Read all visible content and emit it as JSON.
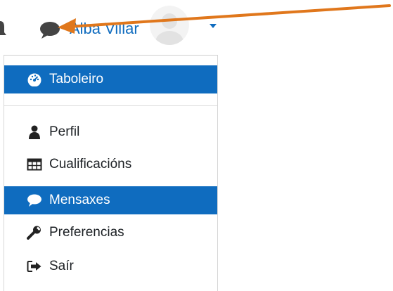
{
  "navbar": {
    "user_name": "Alba Villar",
    "icons": {
      "notifications": "bell-icon",
      "messages": "chat-bubble-icon",
      "avatar": "user-avatar-placeholder",
      "menu_toggle": "caret-down-icon"
    }
  },
  "user_menu": {
    "items": [
      {
        "label": "Taboleiro",
        "icon": "dashboard-gauge-icon",
        "active": true
      },
      {
        "label": "Perfil",
        "icon": "user-icon",
        "active": false
      },
      {
        "label": "Cualificacións",
        "icon": "table-grid-icon",
        "active": false
      },
      {
        "label": "Mensaxes",
        "icon": "chat-bubble-icon",
        "active": true
      },
      {
        "label": "Preferencias",
        "icon": "wrench-icon",
        "active": false
      },
      {
        "label": "Saír",
        "icon": "sign-out-icon",
        "active": false
      }
    ]
  },
  "colors": {
    "accent": "#0f6cbf",
    "annotation_arrow": "#e0771c",
    "text": "#1d2125",
    "icon_dark": "#333333"
  }
}
